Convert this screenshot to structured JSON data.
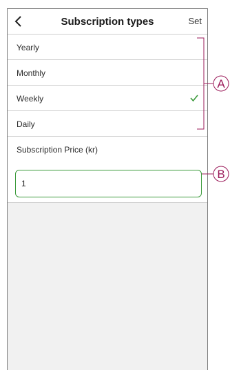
{
  "header": {
    "title": "Subscription types",
    "set_label": "Set"
  },
  "options": [
    {
      "label": "Yearly",
      "selected": false
    },
    {
      "label": "Monthly",
      "selected": false
    },
    {
      "label": "Weekly",
      "selected": true
    },
    {
      "label": "Daily",
      "selected": false
    }
  ],
  "price": {
    "label": "Subscription Price (kr)",
    "value": "1"
  },
  "callouts": {
    "a": "A",
    "b": "B"
  },
  "colors": {
    "accent_green": "#3a9a3a",
    "callout": "#9b1b5a"
  }
}
